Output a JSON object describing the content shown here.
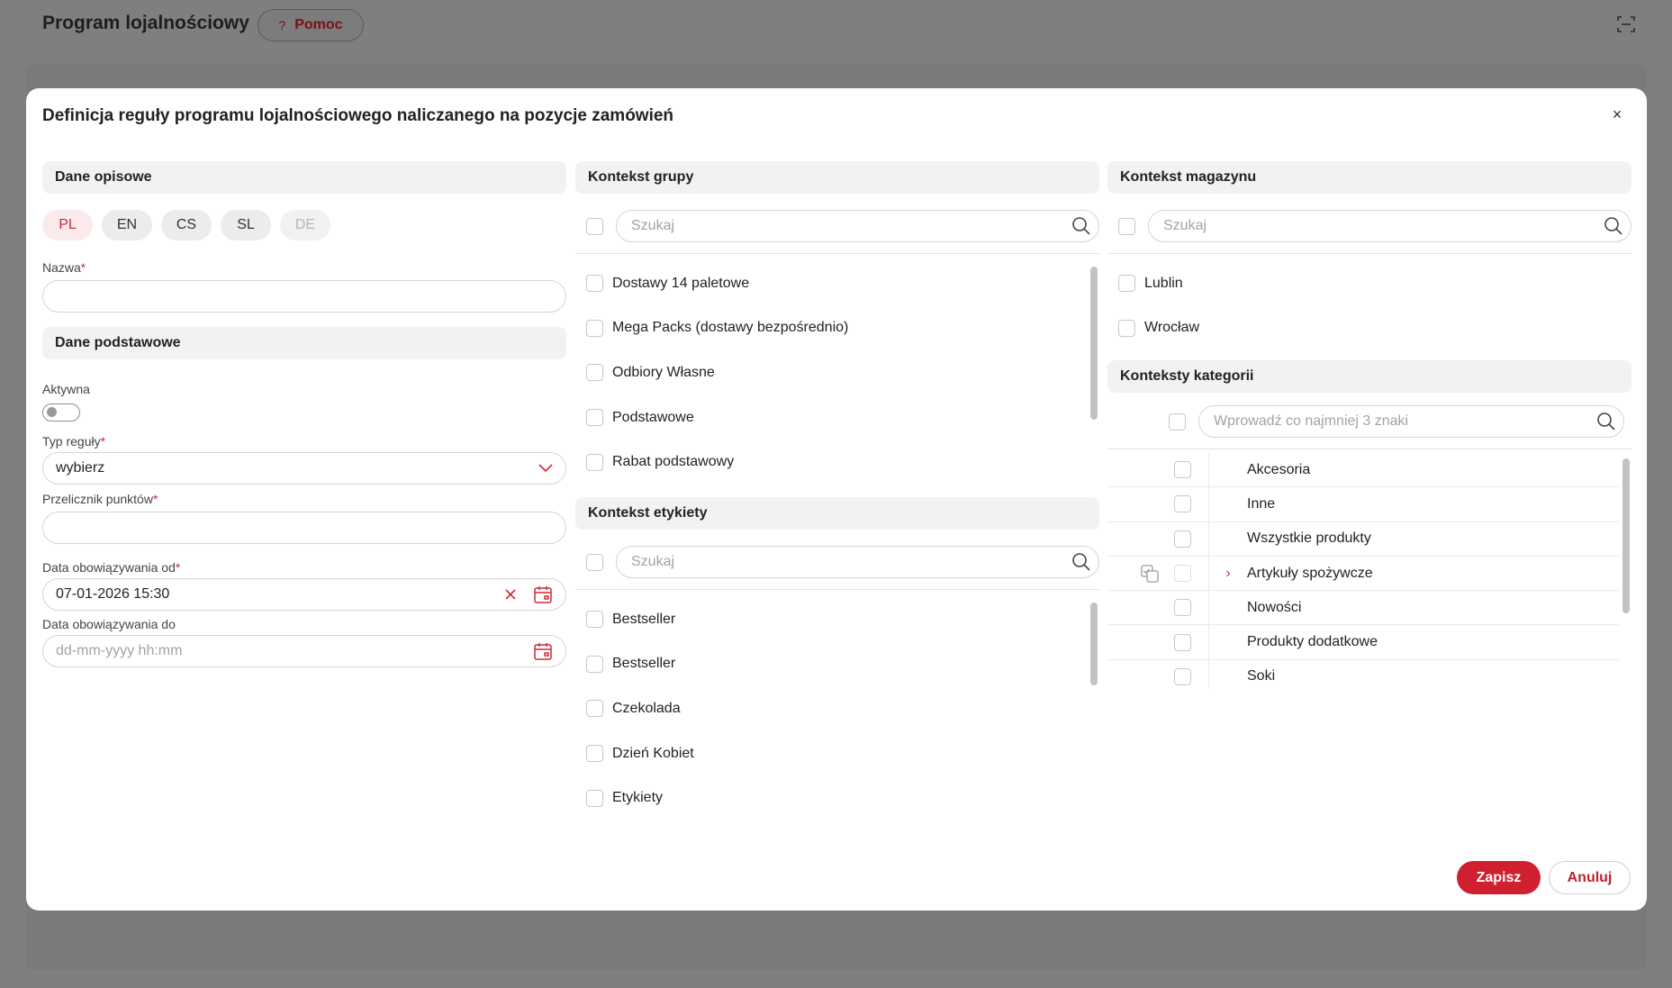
{
  "app": {
    "title": "Program lojalnościowy",
    "help_label": "Pomoc",
    "help_icon": "?"
  },
  "modal": {
    "title": "Definicja reguły programu lojalnościowego naliczanego na pozycje zamówień",
    "close_icon": "×"
  },
  "descriptive": {
    "header": "Dane opisowe",
    "languages": [
      "PL",
      "EN",
      "CS",
      "SL",
      "DE"
    ],
    "name_label": "Nazwa",
    "name_value": ""
  },
  "basic": {
    "header": "Dane podstawowe",
    "active_label": "Aktywna",
    "active": false,
    "rule_type_label": "Typ reguły",
    "rule_type_value": "wybierz",
    "points_label": "Przelicznik punktów",
    "points_value": "",
    "date_from_label": "Data obowiązywania od",
    "date_from_value": "07-01-2026 15:30",
    "date_to_label": "Data obowiązywania do",
    "date_to_placeholder": "dd-mm-yyyy hh:mm"
  },
  "required_mark": "*",
  "group_context": {
    "header": "Kontekst grupy",
    "search_placeholder": "Szukaj",
    "items": [
      "Dostawy 14 paletowe",
      "Mega Packs (dostawy bezpośrednio)",
      "Odbiory Własne",
      "Podstawowe",
      "Rabat podstawowy"
    ]
  },
  "label_context": {
    "header": "Kontekst etykiety",
    "search_placeholder": "Szukaj",
    "items": [
      "Bestseller",
      "Bestseller",
      "Czekolada",
      "Dzień Kobiet",
      "Etykiety"
    ]
  },
  "warehouse_context": {
    "header": "Kontekst magazynu",
    "search_placeholder": "Szukaj",
    "items": [
      "Lublin",
      "Wrocław"
    ]
  },
  "category_context": {
    "header": "Konteksty kategorii",
    "search_placeholder": "Wprowadź co najmniej 3 znaki",
    "items": [
      "Akcesoria",
      "Inne",
      "Wszystkie produkty",
      "Artykuły spożywcze",
      "Nowości",
      "Produkty dodatkowe",
      "Soki"
    ],
    "expand_icon": "›"
  },
  "actions": {
    "save": "Zapisz",
    "cancel": "Anuluj"
  },
  "colors": {
    "accent": "#d0202f",
    "overlay": "#7f7f7f"
  }
}
